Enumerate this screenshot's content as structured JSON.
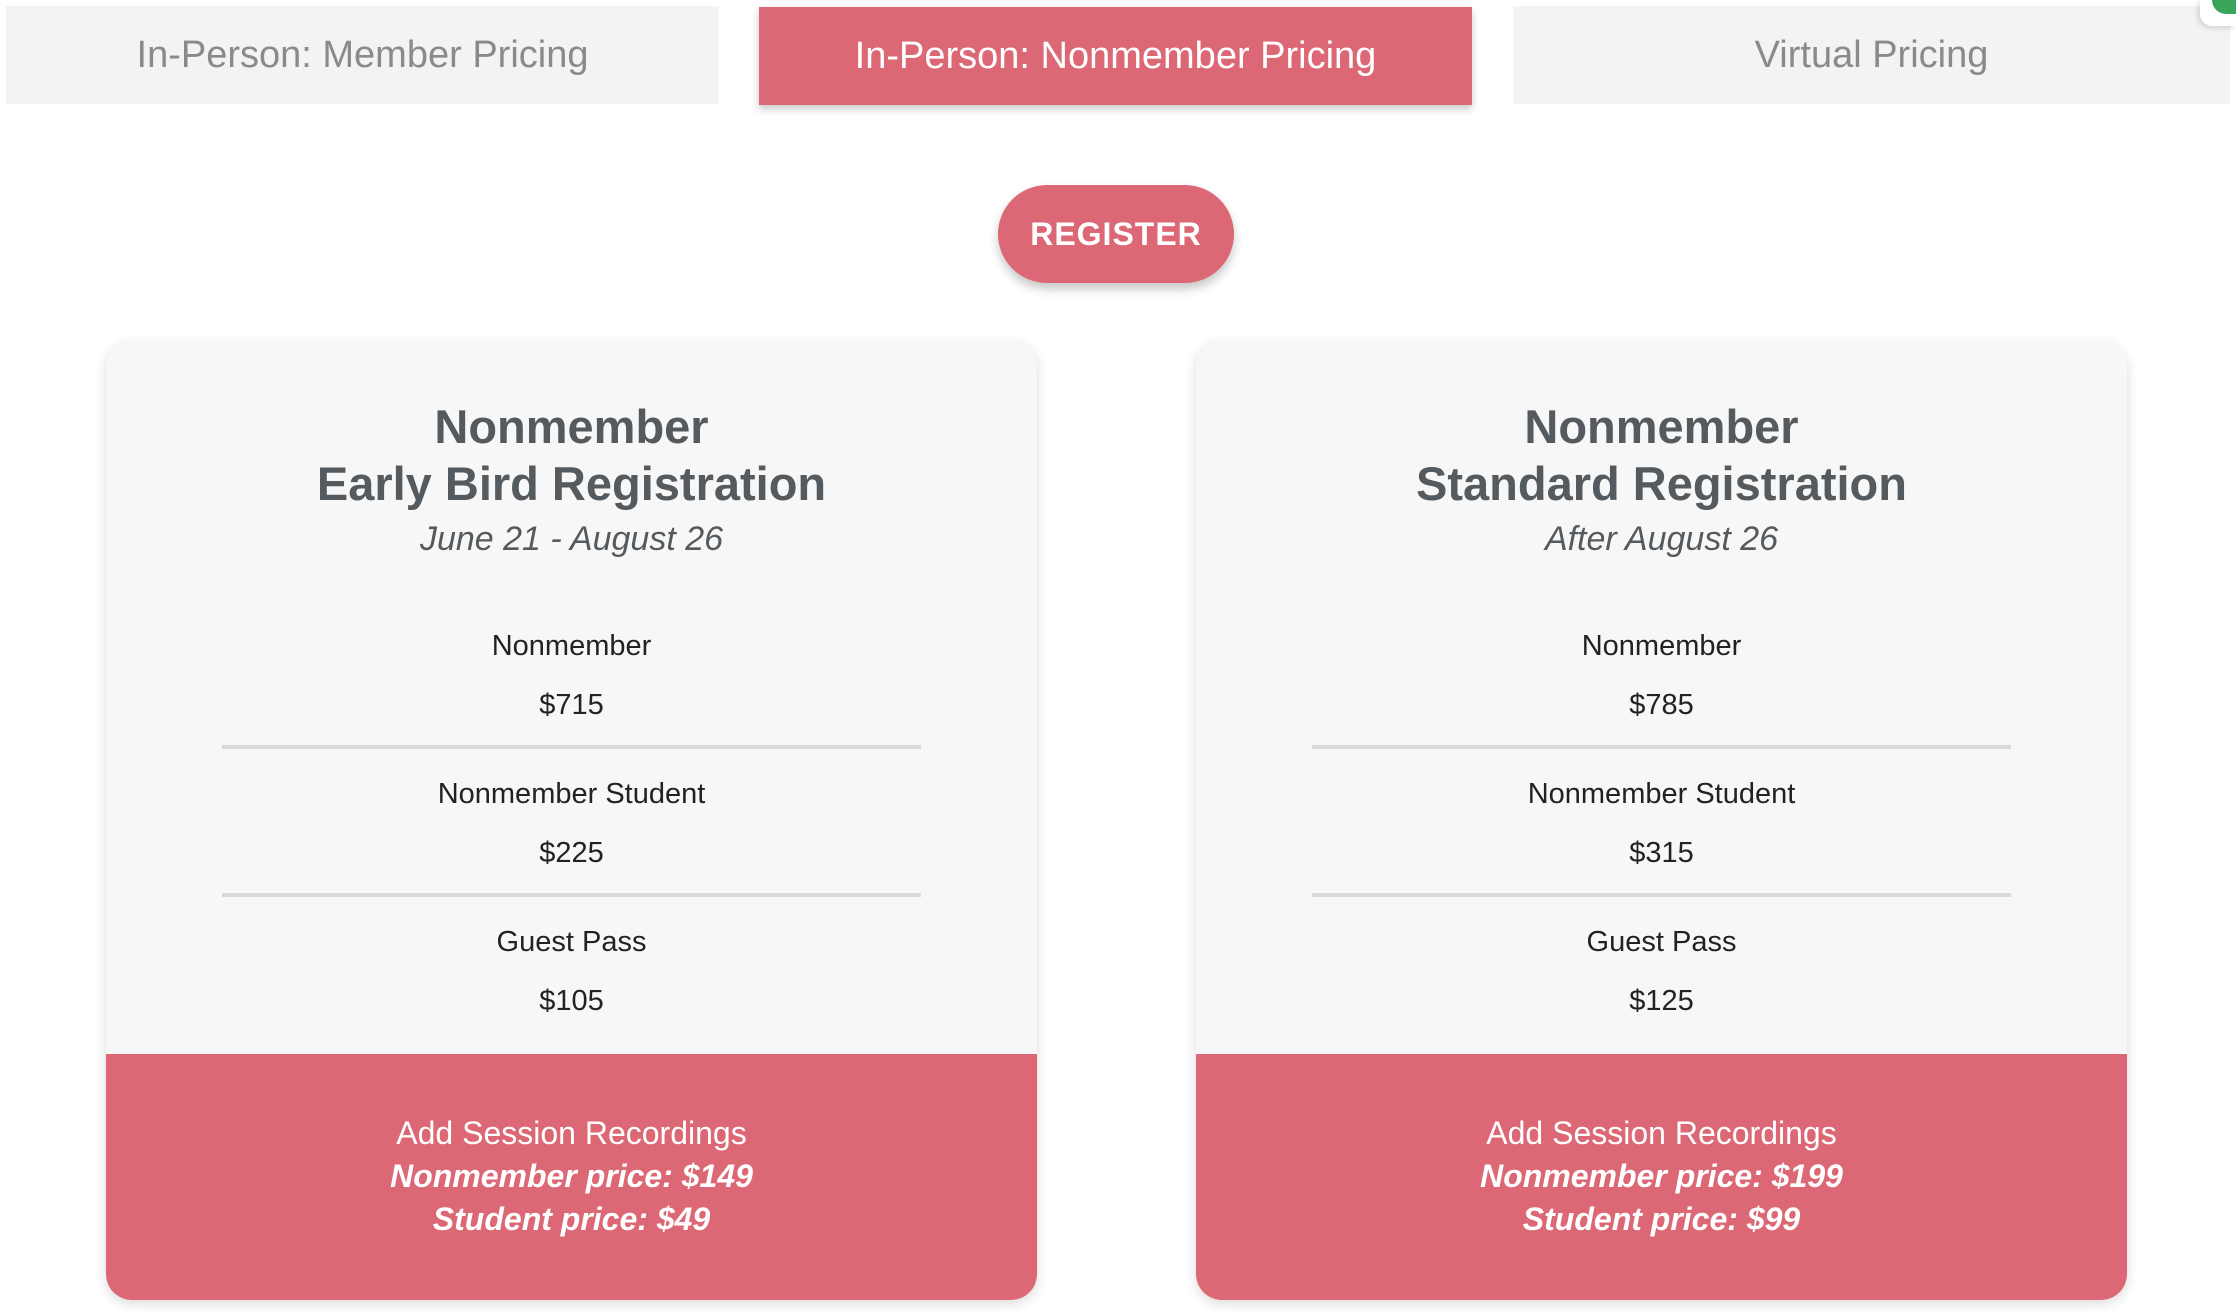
{
  "tabs": [
    {
      "label": "In-Person: Member Pricing",
      "active": false
    },
    {
      "label": "In-Person: Nonmember Pricing",
      "active": true
    },
    {
      "label": "Virtual Pricing",
      "active": false
    }
  ],
  "register": {
    "label": "REGISTER"
  },
  "colors": {
    "accent": "#dc6875",
    "tab_inactive": "#f3f3f3",
    "card_bg": "#f7f7f7",
    "heading": "#555a5e"
  },
  "cards": [
    {
      "title_line1": "Nonmember",
      "title_line2": "Early Bird Registration",
      "dates": "June 21 - August 26",
      "prices": [
        {
          "label": "Nonmember",
          "amount": "$715"
        },
        {
          "label": "Nonmember Student",
          "amount": "$225"
        },
        {
          "label": "Guest Pass",
          "amount": "$105"
        }
      ],
      "footer": {
        "heading": "Add Session Recordings",
        "line1": "Nonmember price: $149",
        "line2": "Student price: $49"
      }
    },
    {
      "title_line1": "Nonmember",
      "title_line2": "Standard Registration",
      "dates": "After August 26",
      "prices": [
        {
          "label": "Nonmember",
          "amount": "$785"
        },
        {
          "label": "Nonmember Student",
          "amount": "$315"
        },
        {
          "label": "Guest Pass",
          "amount": "$125"
        }
      ],
      "footer": {
        "heading": "Add Session Recordings",
        "line1": "Nonmember price: $199",
        "line2": "Student price: $99"
      }
    }
  ]
}
